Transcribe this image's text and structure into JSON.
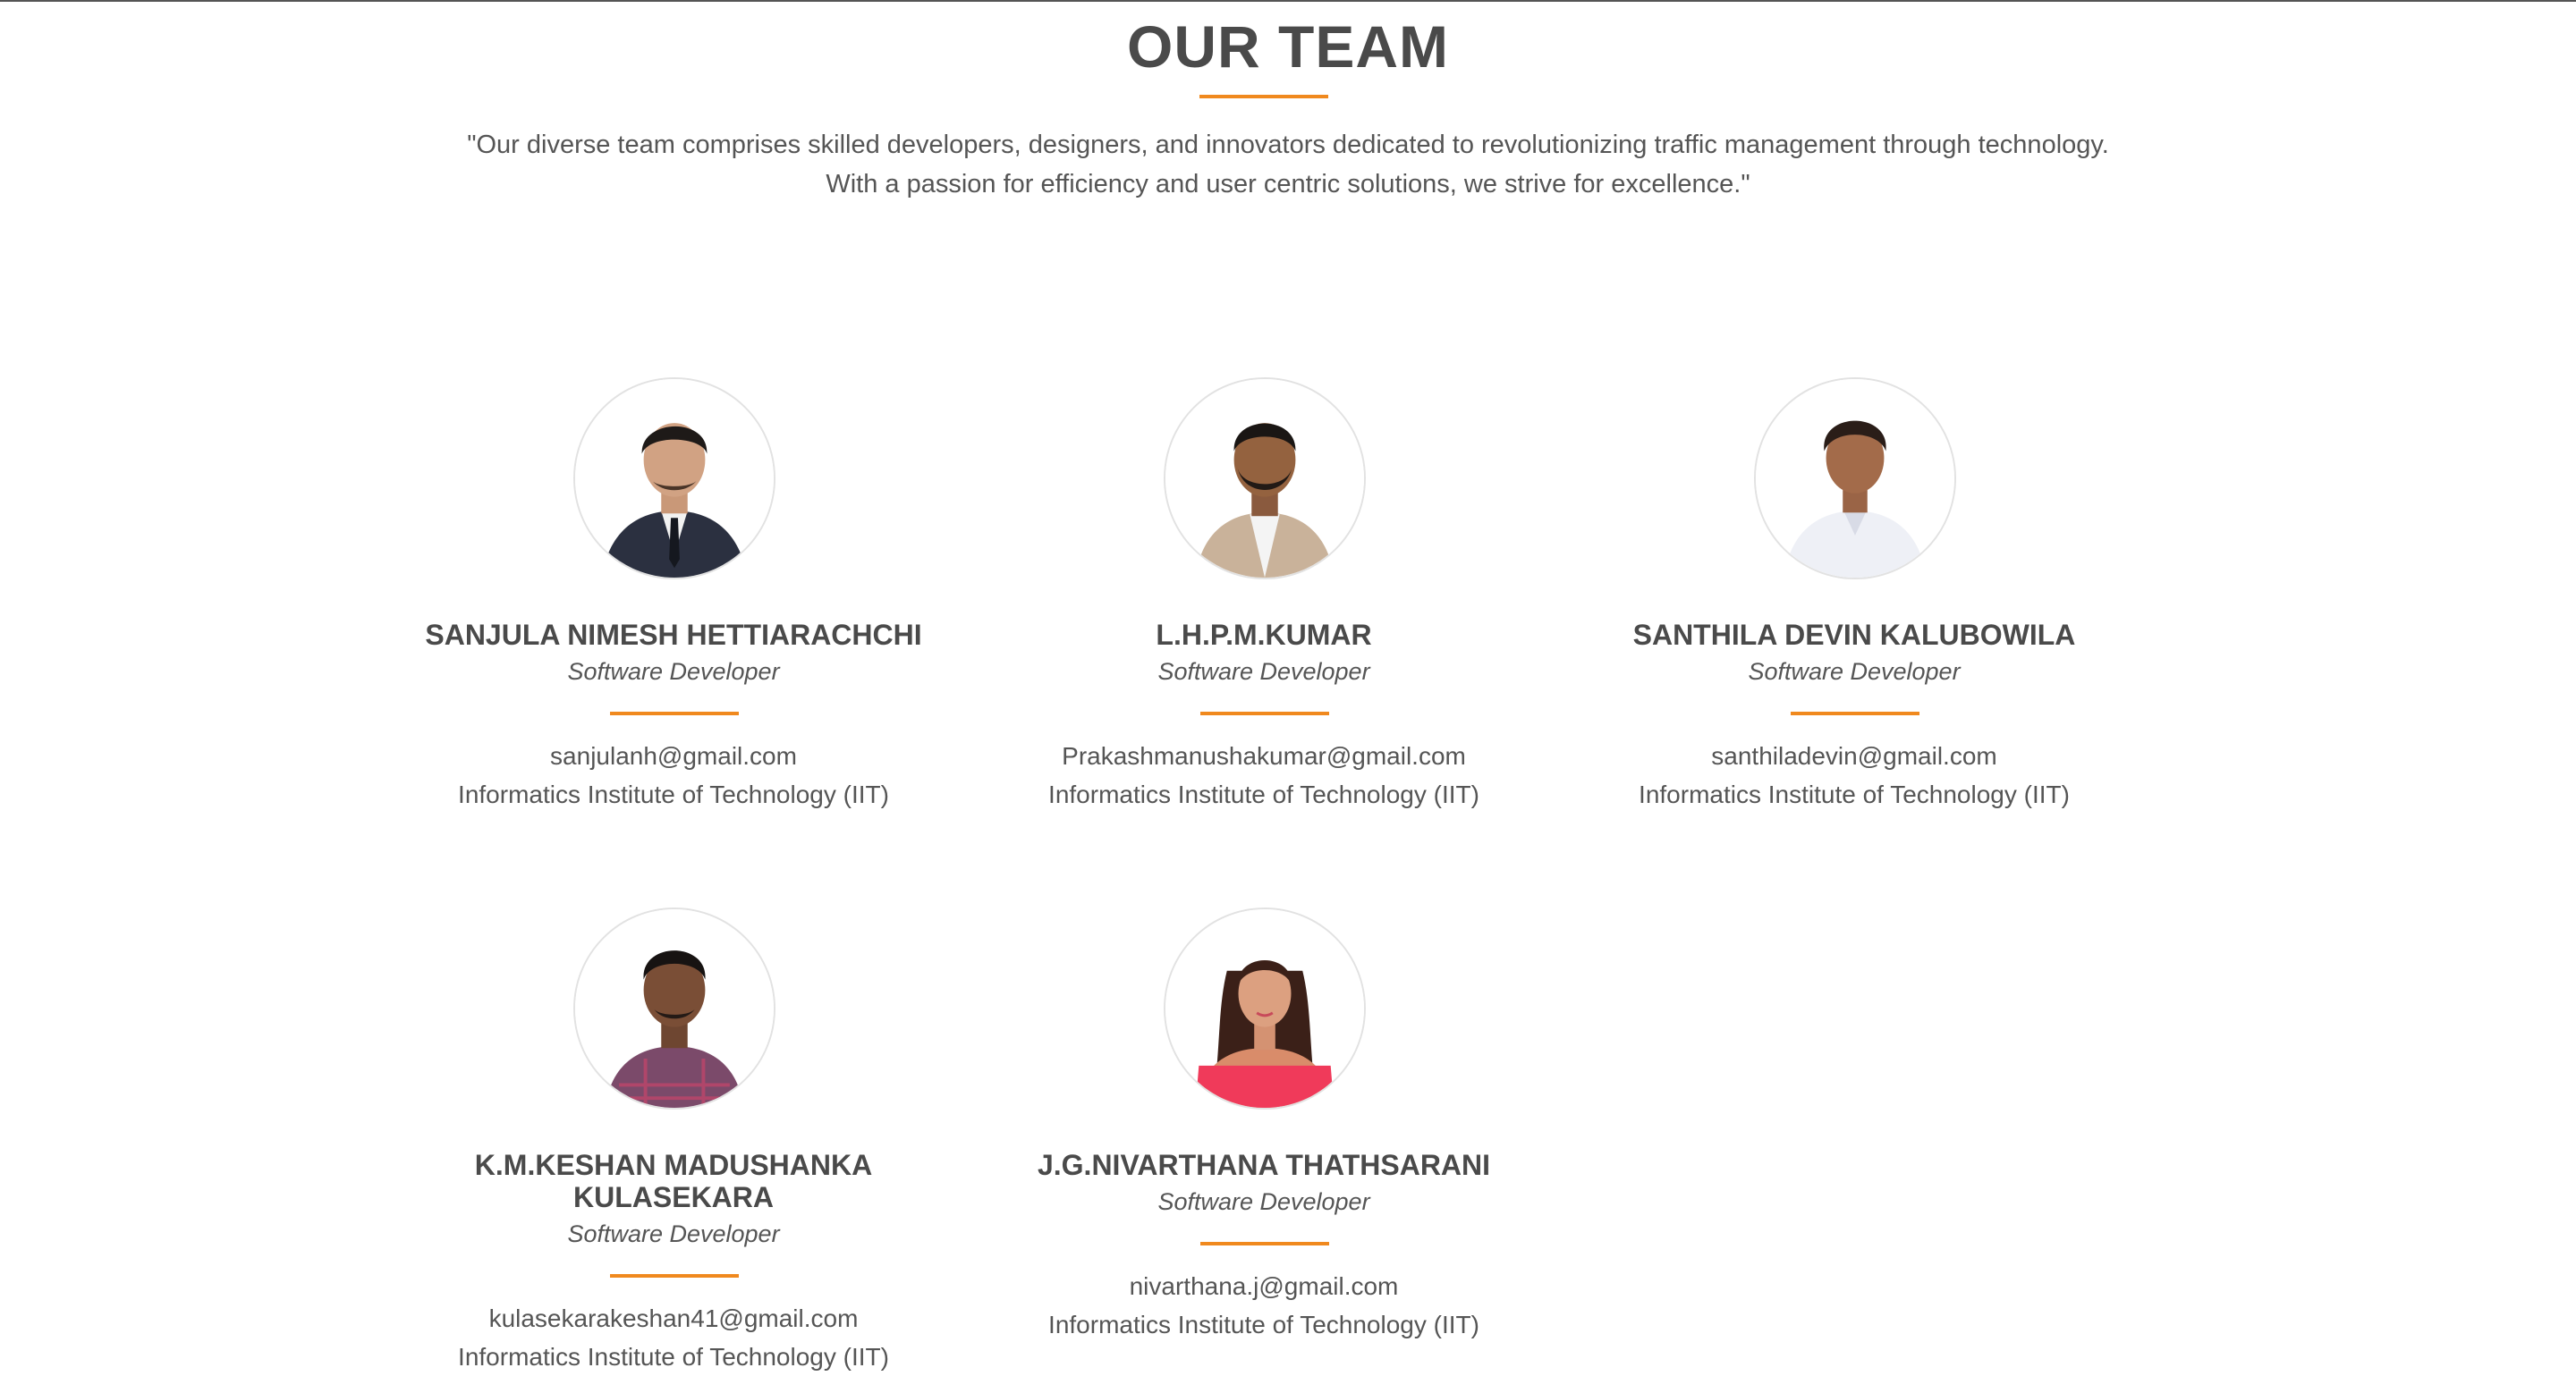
{
  "section": {
    "title": "OUR TEAM",
    "intro": "\"Our diverse team comprises skilled developers, designers, and innovators dedicated to revolutionizing traffic management through technology. With a passion for efficiency and user centric solutions, we strive for excellence.\""
  },
  "members": [
    {
      "name": "SANJULA NIMESH HETTIARACHCHI",
      "role": "Software Developer",
      "email": "sanjulanh@gmail.com",
      "org": "Informatics Institute of Technology (IIT)",
      "avatar_icon": "profile-photo"
    },
    {
      "name": "L.H.P.M.KUMAR",
      "role": "Software Developer",
      "email": "Prakashmanushakumar@gmail.com",
      "org": "Informatics Institute of Technology (IIT)",
      "avatar_icon": "profile-photo"
    },
    {
      "name": "SANTHILA DEVIN KALUBOWILA",
      "role": "Software Developer",
      "email": "santhiladevin@gmail.com",
      "org": "Informatics Institute of Technology (IIT)",
      "avatar_icon": "profile-photo"
    },
    {
      "name": "K.M.KESHAN MADUSHANKA KULASEKARA",
      "role": "Software Developer",
      "email": "kulasekarakeshan41@gmail.com",
      "org": "Informatics Institute of Technology (IIT)",
      "avatar_icon": "profile-photo"
    },
    {
      "name": "J.G.NIVARTHANA THATHSARANI",
      "role": "Software Developer",
      "email": "nivarthana.j@gmail.com",
      "org": "Informatics Institute of Technology (IIT)",
      "avatar_icon": "profile-photo"
    }
  ],
  "colors": {
    "accent": "#f0891e",
    "heading": "#4a4a4a",
    "text": "#555555"
  }
}
